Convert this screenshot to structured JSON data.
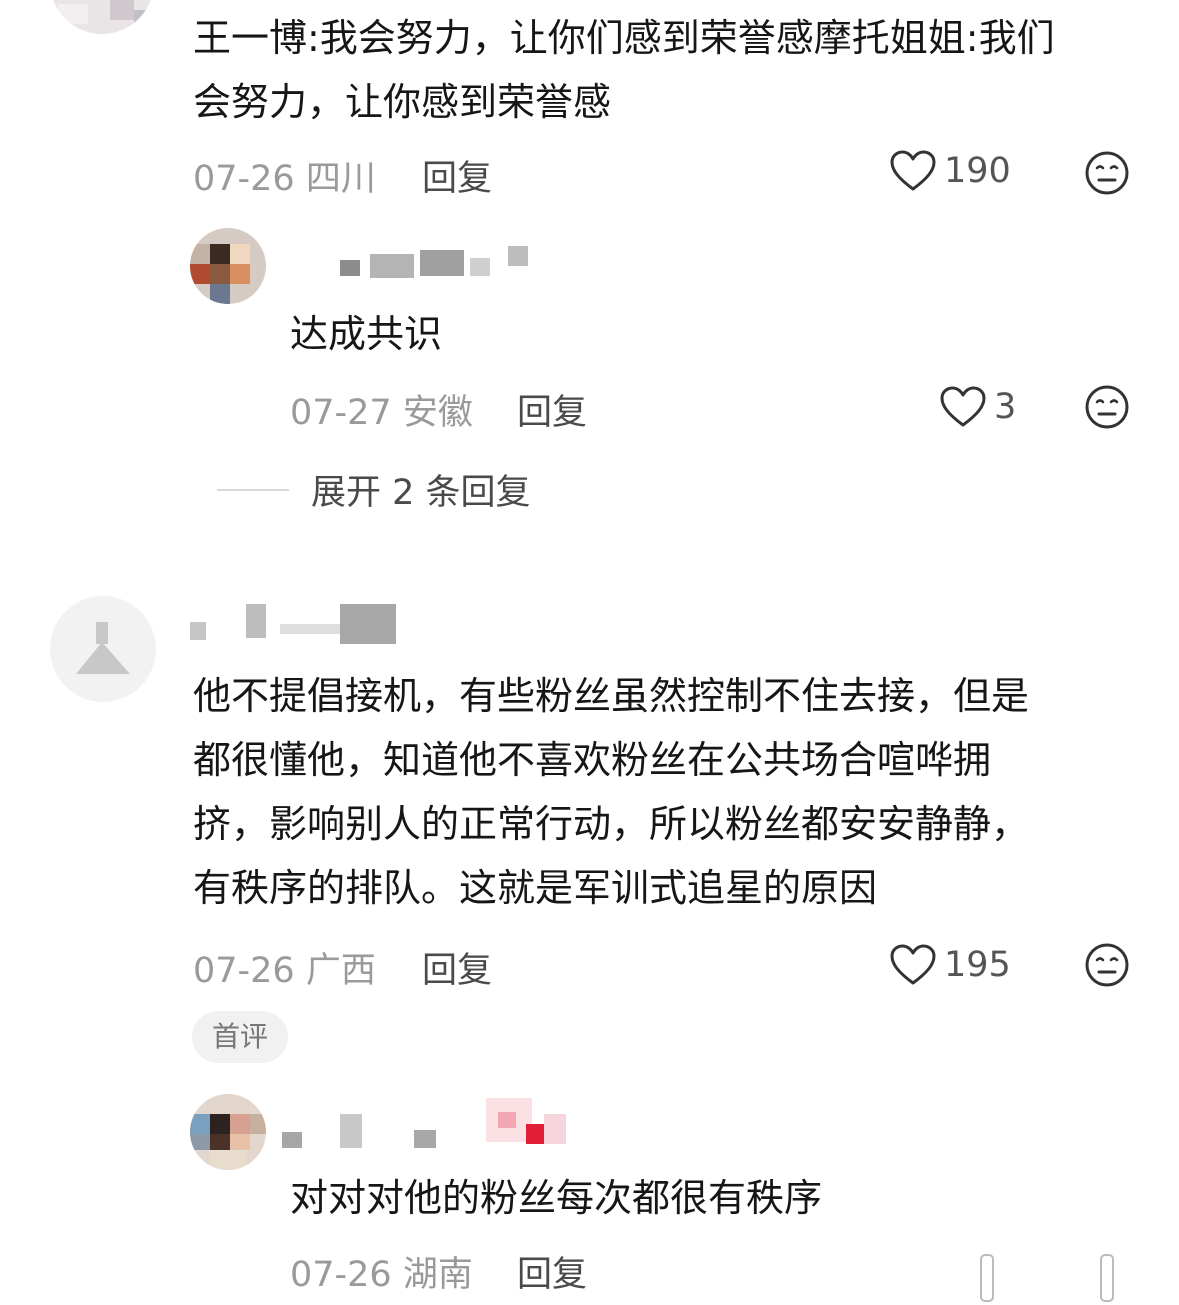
{
  "comments": [
    {
      "text_lines": [
        "王一博:我会努力，让你们感到荣誉感摩托姐姐:我们",
        "会努力，让你感到荣誉感"
      ],
      "date": "07-26",
      "location": "四川",
      "reply_label": "回复",
      "likes": "190",
      "reply": {
        "text": "达成共识",
        "date": "07-27",
        "location": "安徽",
        "reply_label": "回复",
        "likes": "3"
      },
      "expand_label": "展开 2 条回复"
    },
    {
      "text_lines": [
        "他不提倡接机，有些粉丝虽然控制不住去接，但是",
        "都很懂他，知道他不喜欢粉丝在公共场合喧哗拥",
        "挤，影响别人的正常行动，所以粉丝都安安静静，",
        "有秩序的排队。这就是军训式追星的原因"
      ],
      "date": "07-26",
      "location": "广西",
      "reply_label": "回复",
      "likes": "195",
      "badge": "首评",
      "reply": {
        "text": "对对对他的粉丝每次都很有秩序",
        "date": "07-26",
        "location": "湖南",
        "reply_label": "回复"
      }
    }
  ],
  "icons": {
    "like": "heart-outline-icon",
    "dislike": "neutral-face-icon"
  },
  "colors": {
    "text": "#161616",
    "meta": "#9a9a9a",
    "action": "#4a4a4a"
  }
}
